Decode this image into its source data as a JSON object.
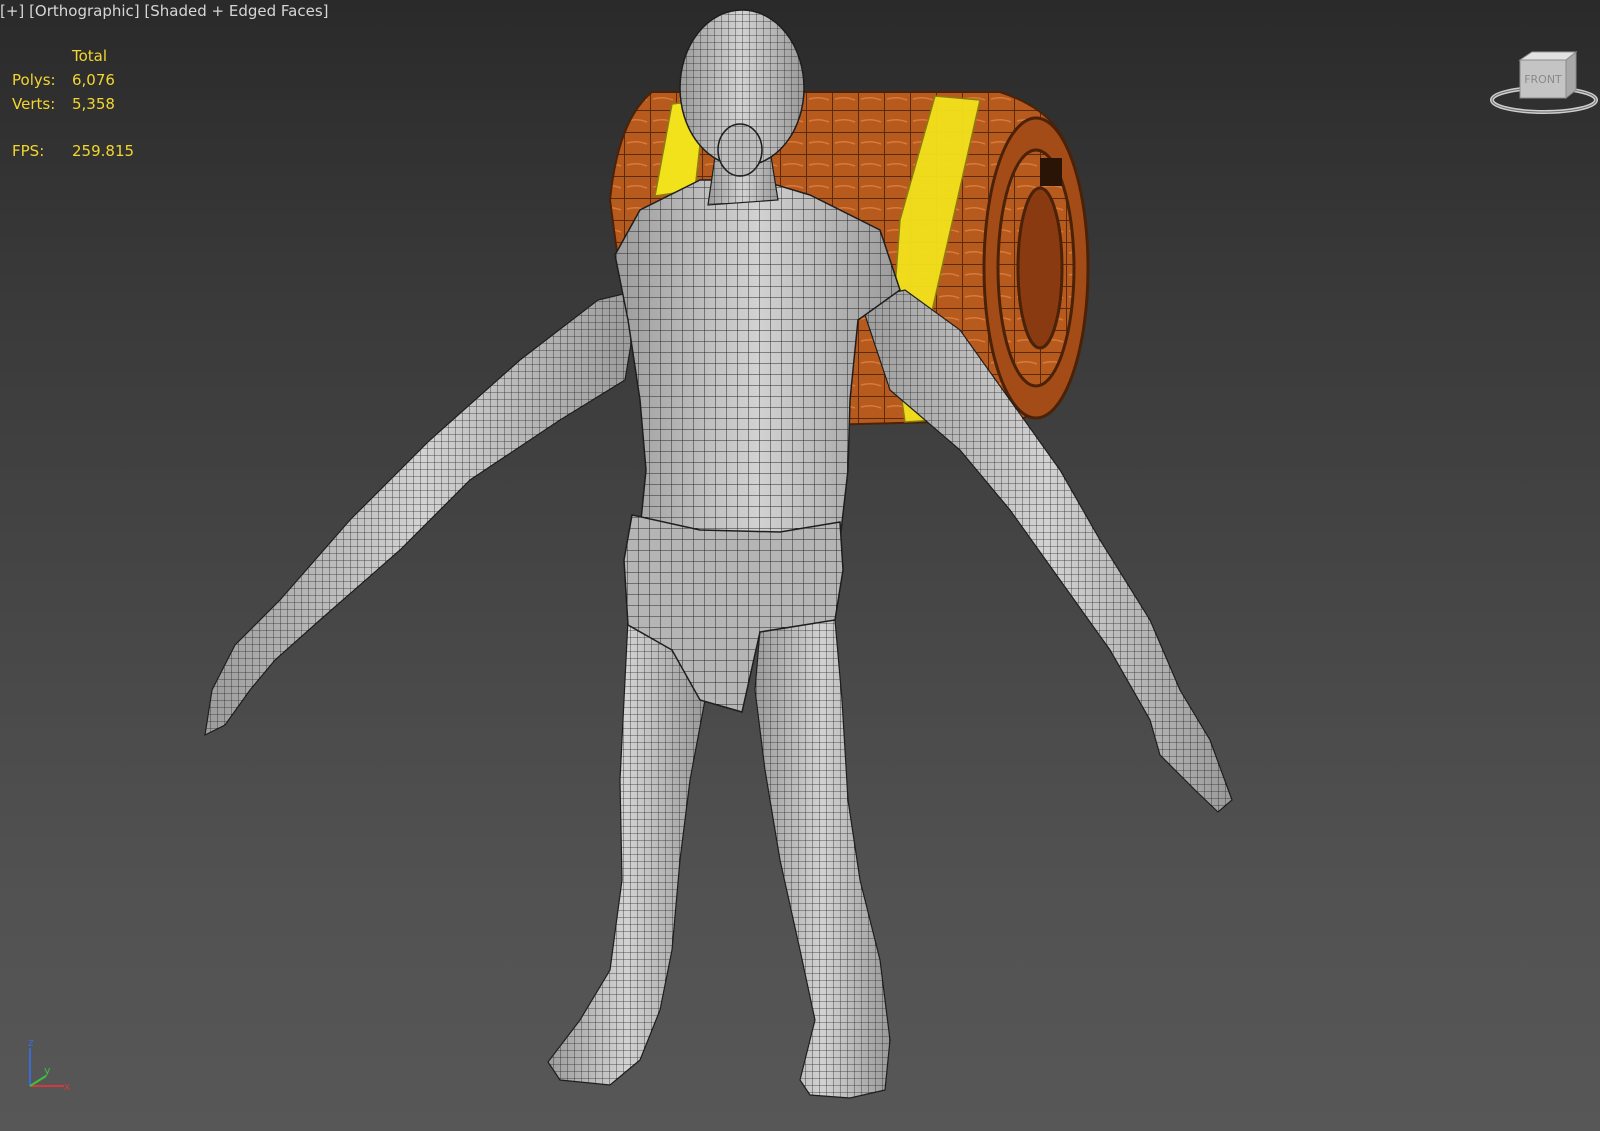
{
  "viewport": {
    "label_plus": "[+]",
    "label_view": "[Orthographic]",
    "label_shading": "[Shaded + Edged Faces]"
  },
  "stats": {
    "header": "Total",
    "polys_label": "Polys:",
    "polys_value": "6,076",
    "verts_label": "Verts:",
    "verts_value": "5,358",
    "fps_label": "FPS:",
    "fps_value": "259.815"
  },
  "viewcube": {
    "face_label": "FRONT",
    "icon": "viewcube-icon"
  },
  "axis": {
    "x": "x",
    "y": "y",
    "z": "z"
  },
  "colors": {
    "stats_text": "#f2d631",
    "mesh": "#c8c8c8",
    "wire": "#2b2b2b",
    "wood": "#b75a1e",
    "band": "#f2e21c",
    "axis_x": "#d23a3a",
    "axis_y": "#3ec23e",
    "axis_z": "#3a6ad6"
  },
  "scene": {
    "object_type": "character-mesh-with-barrel"
  }
}
